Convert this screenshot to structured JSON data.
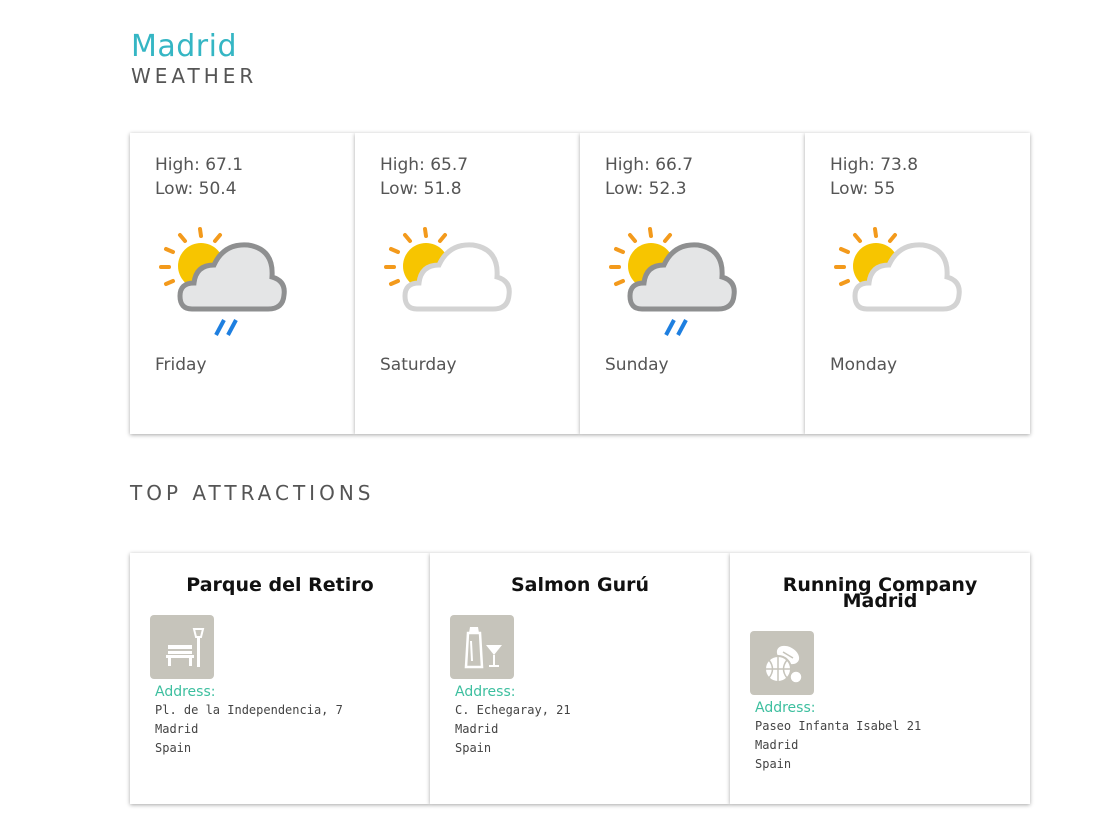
{
  "header": {
    "city": "Madrid",
    "subtitle": "WEATHER"
  },
  "forecast": [
    {
      "high": "High: 67.1",
      "low": "Low: 50.4",
      "day": "Friday",
      "icon": "partly-cloudy-rain-icon"
    },
    {
      "high": "High: 65.7",
      "low": "Low: 51.8",
      "day": "Saturday",
      "icon": "partly-cloudy-icon"
    },
    {
      "high": "High: 66.7",
      "low": "Low: 52.3",
      "day": "Sunday",
      "icon": "partly-cloudy-rain-icon"
    },
    {
      "high": "High: 73.8",
      "low": "Low: 55",
      "day": "Monday",
      "icon": "partly-cloudy-icon"
    }
  ],
  "attractions_title": "TOP ATTRACTIONS",
  "attractions": [
    {
      "name": "Parque del Retiro",
      "icon": "park-bench-icon",
      "address_label": "Address:",
      "line1": "Pl. de la Independencia, 7",
      "line2": "Madrid",
      "line3": "Spain"
    },
    {
      "name": "Salmon Gurú",
      "icon": "cocktail-bar-icon",
      "address_label": "Address:",
      "line1": "C. Echegaray, 21",
      "line2": "Madrid",
      "line3": "Spain"
    },
    {
      "name": "Running Company Madrid",
      "name_line1": "Running Company",
      "name_line2": "Madrid",
      "icon": "sports-balls-icon",
      "address_label": "Address:",
      "line1": "Paseo Infanta Isabel 21",
      "line2": "Madrid",
      "line3": "Spain"
    }
  ],
  "colors": {
    "accent": "#35b6c4",
    "address_label": "#3dbf9f",
    "icon_bg": "#c6c4bb",
    "sun": "#f7c500",
    "rain": "#1e7fe0"
  }
}
